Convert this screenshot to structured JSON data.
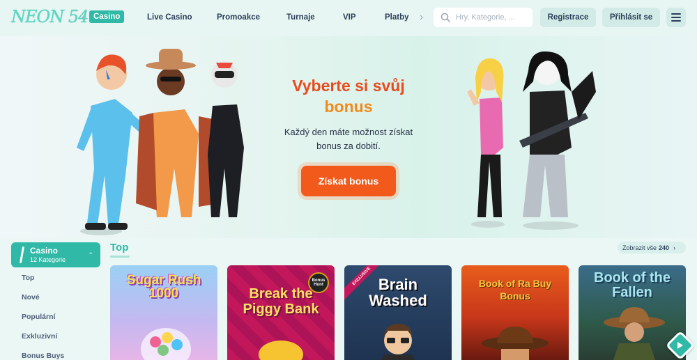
{
  "header": {
    "logo": "NEON 54",
    "nav": [
      "Casino",
      "Live Casino",
      "Promoakce",
      "Turnaje",
      "VIP",
      "Platby"
    ],
    "search_placeholder": "Hry, Kategorie, ...",
    "register_label": "Registrace",
    "login_label": "Přihlásit se"
  },
  "hero": {
    "title_line1": "Vyberte si svůj",
    "title_line2": "bonus",
    "subtitle_line1": "Každý den máte možnost získat",
    "subtitle_line2": "bonus za dobití.",
    "cta_label": "Získat bonus"
  },
  "sidebar": {
    "active_title": "Casino",
    "active_subtitle": "12 Kategorie",
    "items": [
      "Top",
      "Nové",
      "Populární",
      "Exkluzivní",
      "Bonus Buys"
    ]
  },
  "games": {
    "section_title": "Top",
    "show_all_label": "Zobrazit vše",
    "show_all_count": "240",
    "tiles": [
      {
        "title": "Sugar Rush 1000"
      },
      {
        "title": "Break the Piggy Bank",
        "badge": "Bonus Hunt"
      },
      {
        "title": "Brain Washed",
        "badge": "EXCLUSIVE"
      },
      {
        "title": "Book of Ra Buy Bonus"
      },
      {
        "title": "Book of the Fallen"
      }
    ]
  },
  "colors": {
    "accent": "#2fb9a6",
    "hero_title": "#e74c1f",
    "hero_title2": "#f08a1b",
    "cta": "#f25a1c"
  }
}
